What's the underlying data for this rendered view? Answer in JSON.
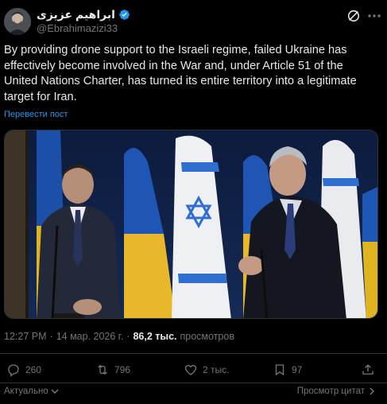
{
  "author": {
    "display_name": "ابراهیم عزیزی",
    "handle": "@Ebrahimazizi33",
    "avatar_icon": "profile-photo",
    "verified_icon": "verified-badge-icon"
  },
  "header_icons": {
    "grok": "grok-icon",
    "more": "more-icon"
  },
  "tweet": {
    "text": "By providing drone support to the Israeli regime, failed Ukraine has effectively become involved in the War and, under Article 51 of the United Nations Charter, has turned its entire territory into a legitimate target for Iran.",
    "translate_label": "Перевести пост"
  },
  "meta": {
    "time": "12:27 PM",
    "separator": "·",
    "date": "14 мар. 2026 г.",
    "separator2": "·",
    "views_count": "86,2 тыс.",
    "views_label": "просмотров"
  },
  "actions": {
    "replies": "260",
    "reposts": "796",
    "likes": "2 тыс.",
    "bookmarks": "97"
  },
  "footer": {
    "sort_label": "Актуально",
    "quotes_label": "Просмотр цитат"
  },
  "colors": {
    "background": "#000000",
    "text_primary": "#e7e9ea",
    "text_secondary": "#71767b",
    "link": "#1d9bf0",
    "border": "#2f3336",
    "verified": "#1d9bf0"
  }
}
